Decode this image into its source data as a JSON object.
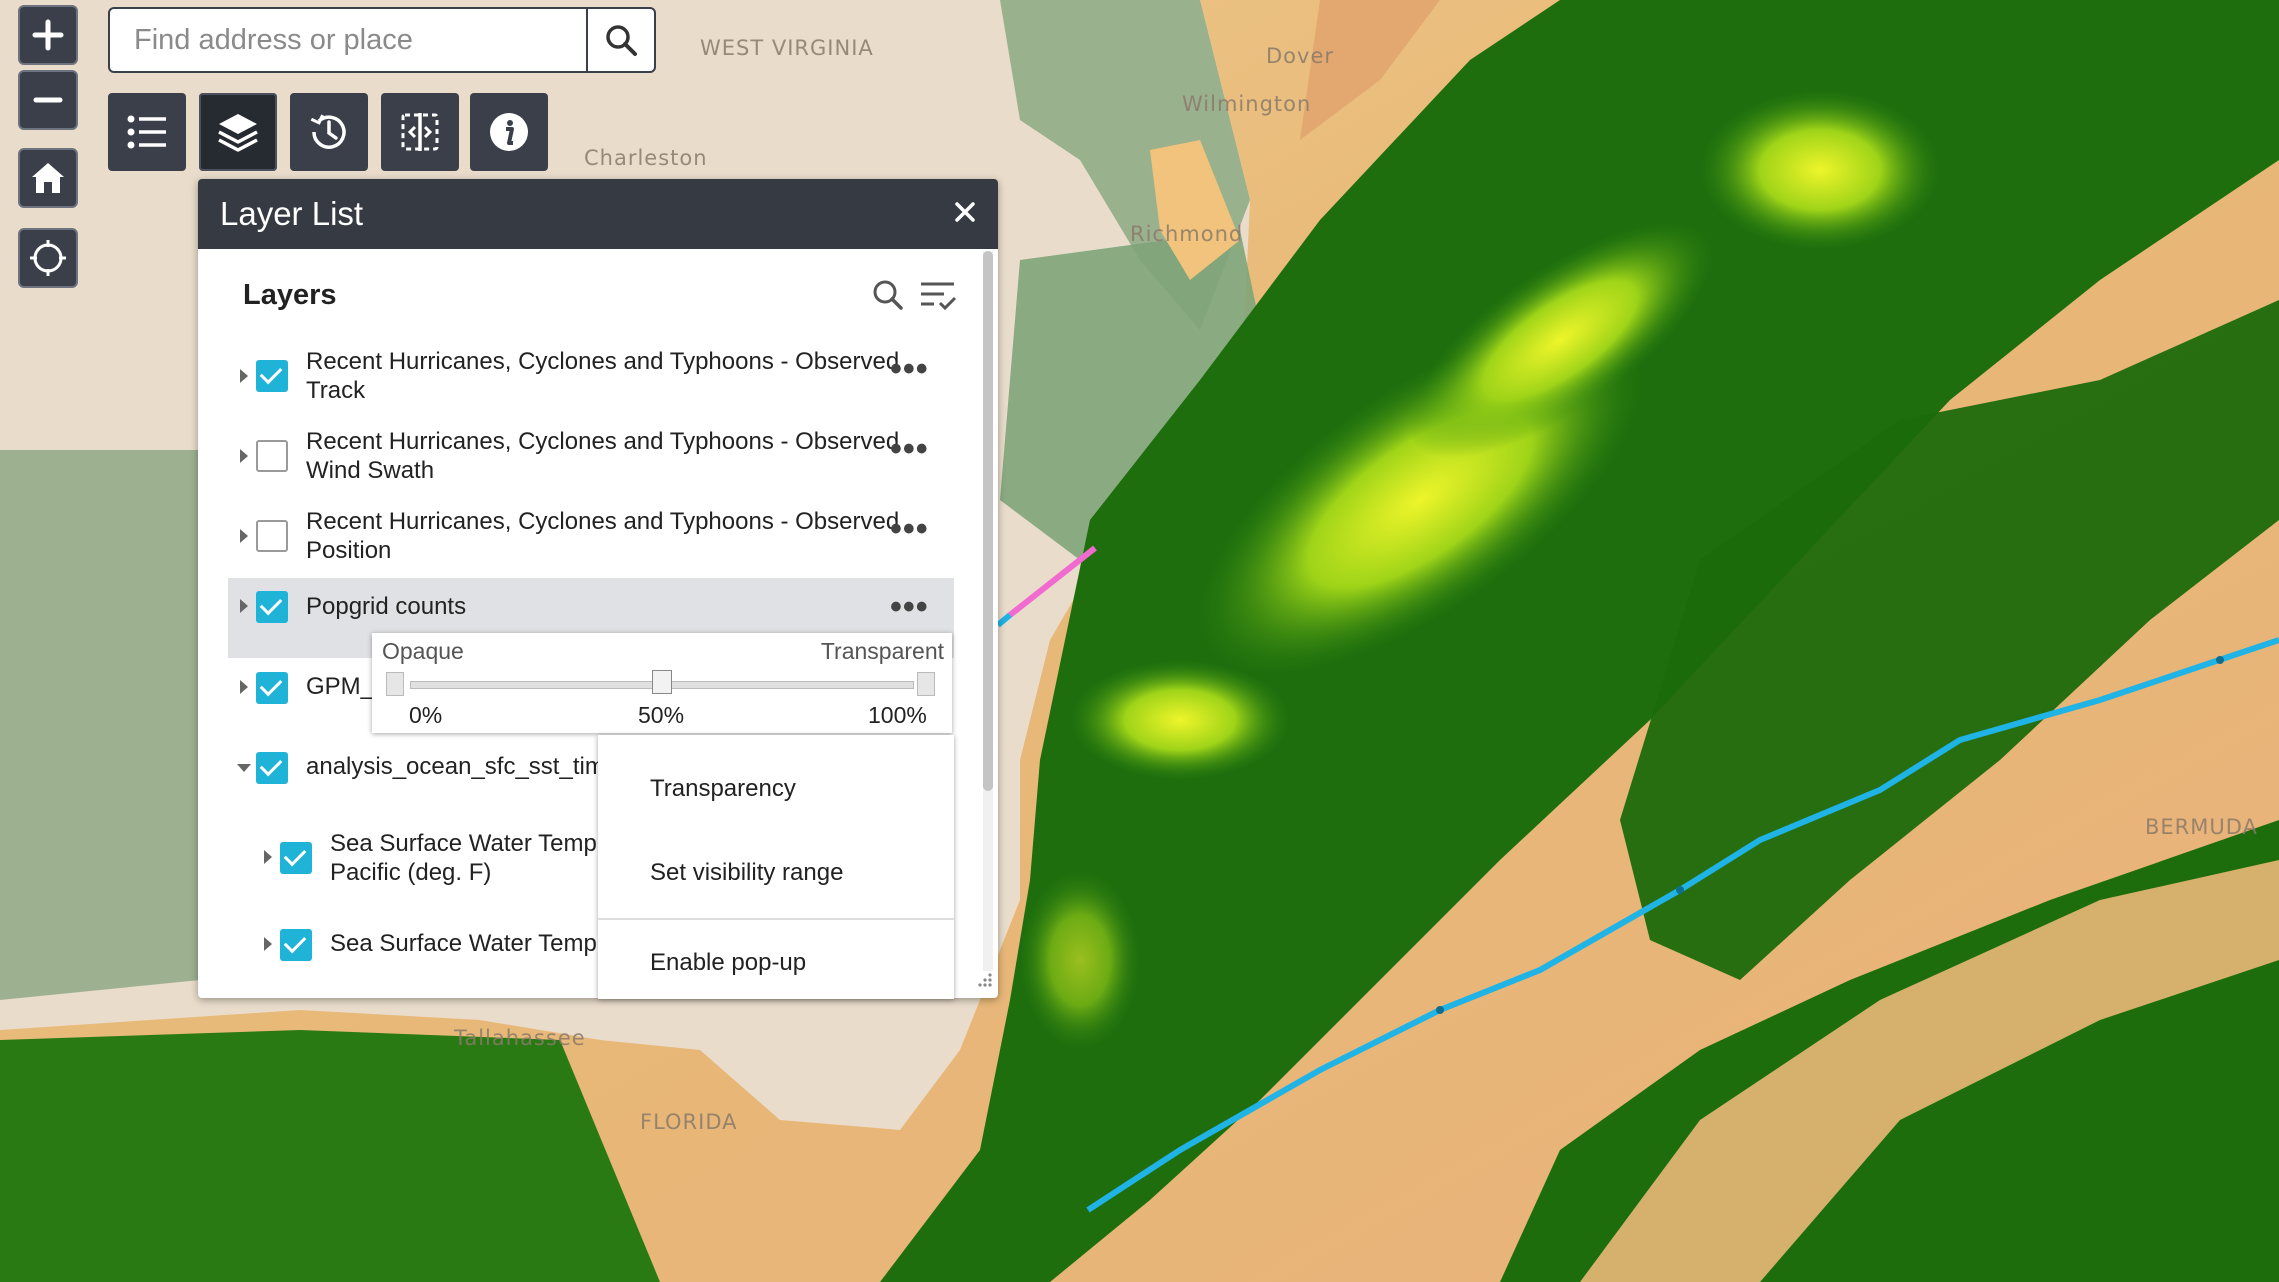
{
  "map": {
    "place_labels": [
      "WEST VIRGINIA",
      "Charleston",
      "Richmond",
      "Wilmington",
      "Dover",
      "Tallahassee",
      "FLORIDA",
      "BERMUDA"
    ]
  },
  "search": {
    "placeholder": "Find address or place"
  },
  "controls": {
    "zoom_in_icon": "plus-icon",
    "zoom_out_icon": "minus-icon",
    "home_icon": "home-icon",
    "locate_icon": "locate-icon"
  },
  "toolbar": {
    "widgets": [
      "legend-icon",
      "layers-icon",
      "history-icon",
      "swipe-icon",
      "info-icon"
    ],
    "active": "layers-icon"
  },
  "layer_list": {
    "title": "Layer List",
    "section_title": "Layers",
    "layers": [
      {
        "name_line1": "Recent Hurricanes, Cyclones and Typhoons - Observed",
        "name_line2": "Track",
        "checked": true
      },
      {
        "name_line1": "Recent Hurricanes, Cyclones and Typhoons - Observed",
        "name_line2": "Wind Swath",
        "checked": false
      },
      {
        "name_line1": "Recent Hurricanes, Cyclones and Typhoons - Observed",
        "name_line2": "Position",
        "checked": false
      },
      {
        "name_line1": "Popgrid counts",
        "checked": true,
        "selected": true
      },
      {
        "name_line1": "GPM_",
        "checked": true
      },
      {
        "name_line1": "analysis_ocean_sfc_sst_tim",
        "checked": true,
        "expanded": true
      },
      {
        "name_line1": "Sea Surface Water Temp",
        "name_line2": "Pacific (deg. F)",
        "checked": true,
        "sublayer": true
      },
      {
        "name_line1": "Sea Surface Water Temp",
        "checked": true,
        "sublayer": true
      }
    ]
  },
  "transparency": {
    "left_label": "Opaque",
    "right_label": "Transparent",
    "ticks": [
      "0%",
      "50%",
      "100%"
    ],
    "value_percent": 50
  },
  "context_menu": {
    "items": [
      "Transparency",
      "Set visibility range",
      "Enable pop-up"
    ]
  },
  "colors": {
    "panel_header": "#363a43",
    "checkbox_on": "#1fb3d8",
    "track_line": "#1fb3e6",
    "track_line_secondary": "#f06ad0",
    "land_green": "#1f6e0e",
    "ocean_orange": "#e7b978"
  }
}
